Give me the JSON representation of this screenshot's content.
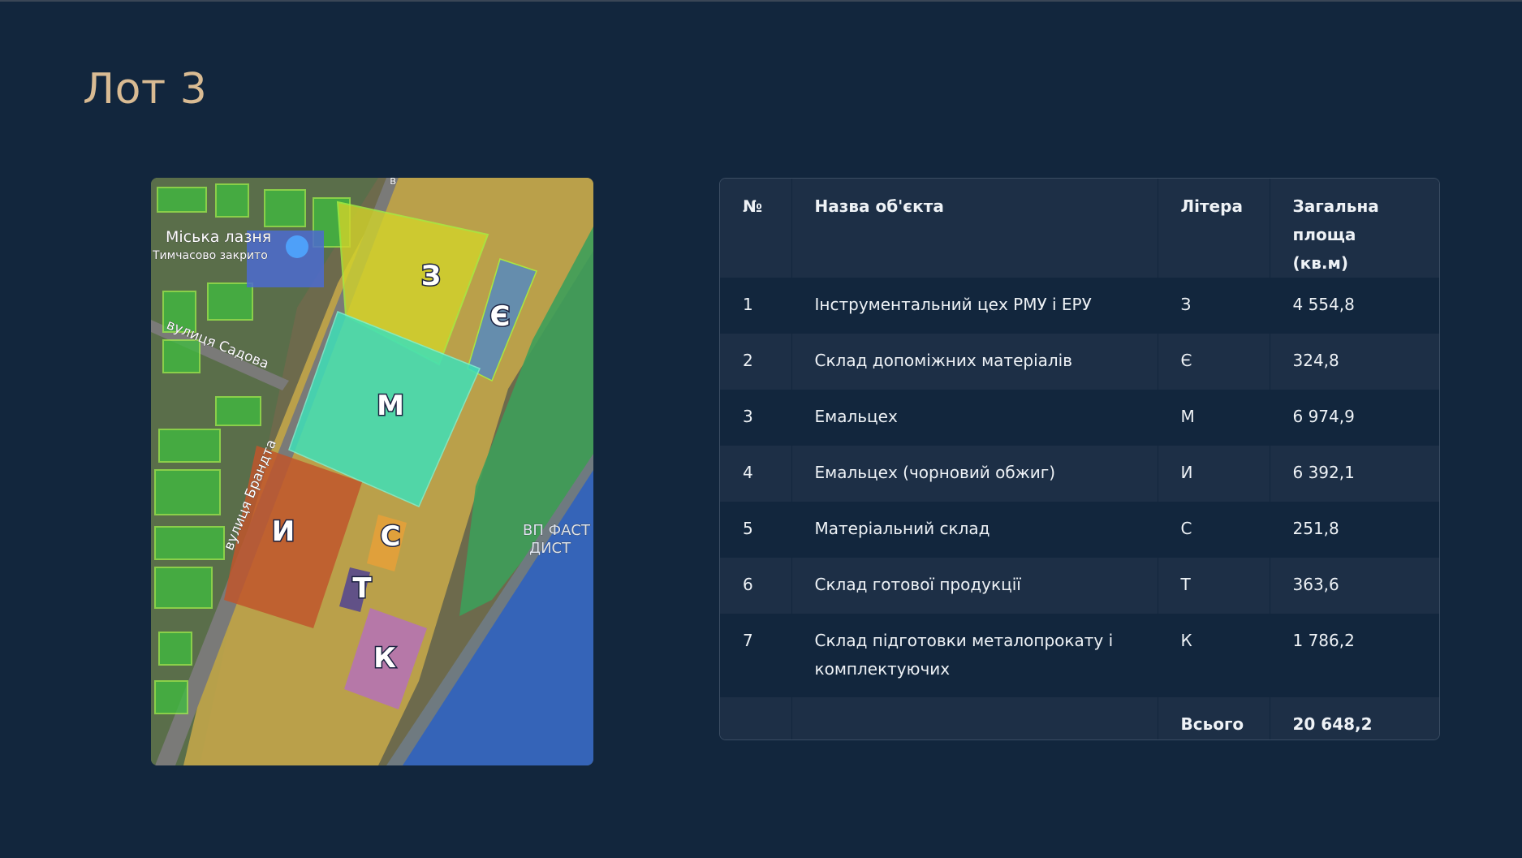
{
  "page": {
    "title": "Лот 3"
  },
  "map": {
    "labels": {
      "z": "З",
      "ye": "Є",
      "m": "М",
      "y": "И",
      "s": "С",
      "t": "Т",
      "k": "К"
    },
    "place_name": "Міська лазня",
    "place_status": "Тимчасово закрито",
    "street_sadova": "вулиця Садова",
    "street_brandta": "вулиця Брандта",
    "map_text_vp": "ВП ФАСТ",
    "map_text_dist": "ДИСТ",
    "map_text_v": "в"
  },
  "table": {
    "headers": {
      "num": "№",
      "name": "Назва об'єкта",
      "letter": "Літера",
      "area_line1": "Загальна",
      "area_line2": "площа (кв.м)"
    },
    "rows": [
      {
        "num": "1",
        "name": "Інструментальний цех РМУ і ЕРУ",
        "letter": "З",
        "area": "4 554,8"
      },
      {
        "num": "2",
        "name": "Склад допоміжних матеріалів",
        "letter": "Є",
        "area": "324,8"
      },
      {
        "num": "3",
        "name": "Емальцех",
        "letter": "М",
        "area": "6 974,9"
      },
      {
        "num": "4",
        "name": "Емальцех (чорновий обжиг)",
        "letter": "И",
        "area": "6 392,1"
      },
      {
        "num": "5",
        "name": "Матеріальний склад",
        "letter": "С",
        "area": "251,8"
      },
      {
        "num": "6",
        "name": "Склад готової продукції",
        "letter": "Т",
        "area": "363,6"
      },
      {
        "num": "7",
        "name": "Склад підготовки металопрокату і комплектуючих",
        "letter": "К",
        "area": "1 786,2"
      }
    ],
    "total_label": "Всього",
    "total_value": "20 648,2"
  },
  "colors": {
    "background": "#12263d",
    "title": "#d9bb93",
    "row_alt": "#1d2f46"
  }
}
